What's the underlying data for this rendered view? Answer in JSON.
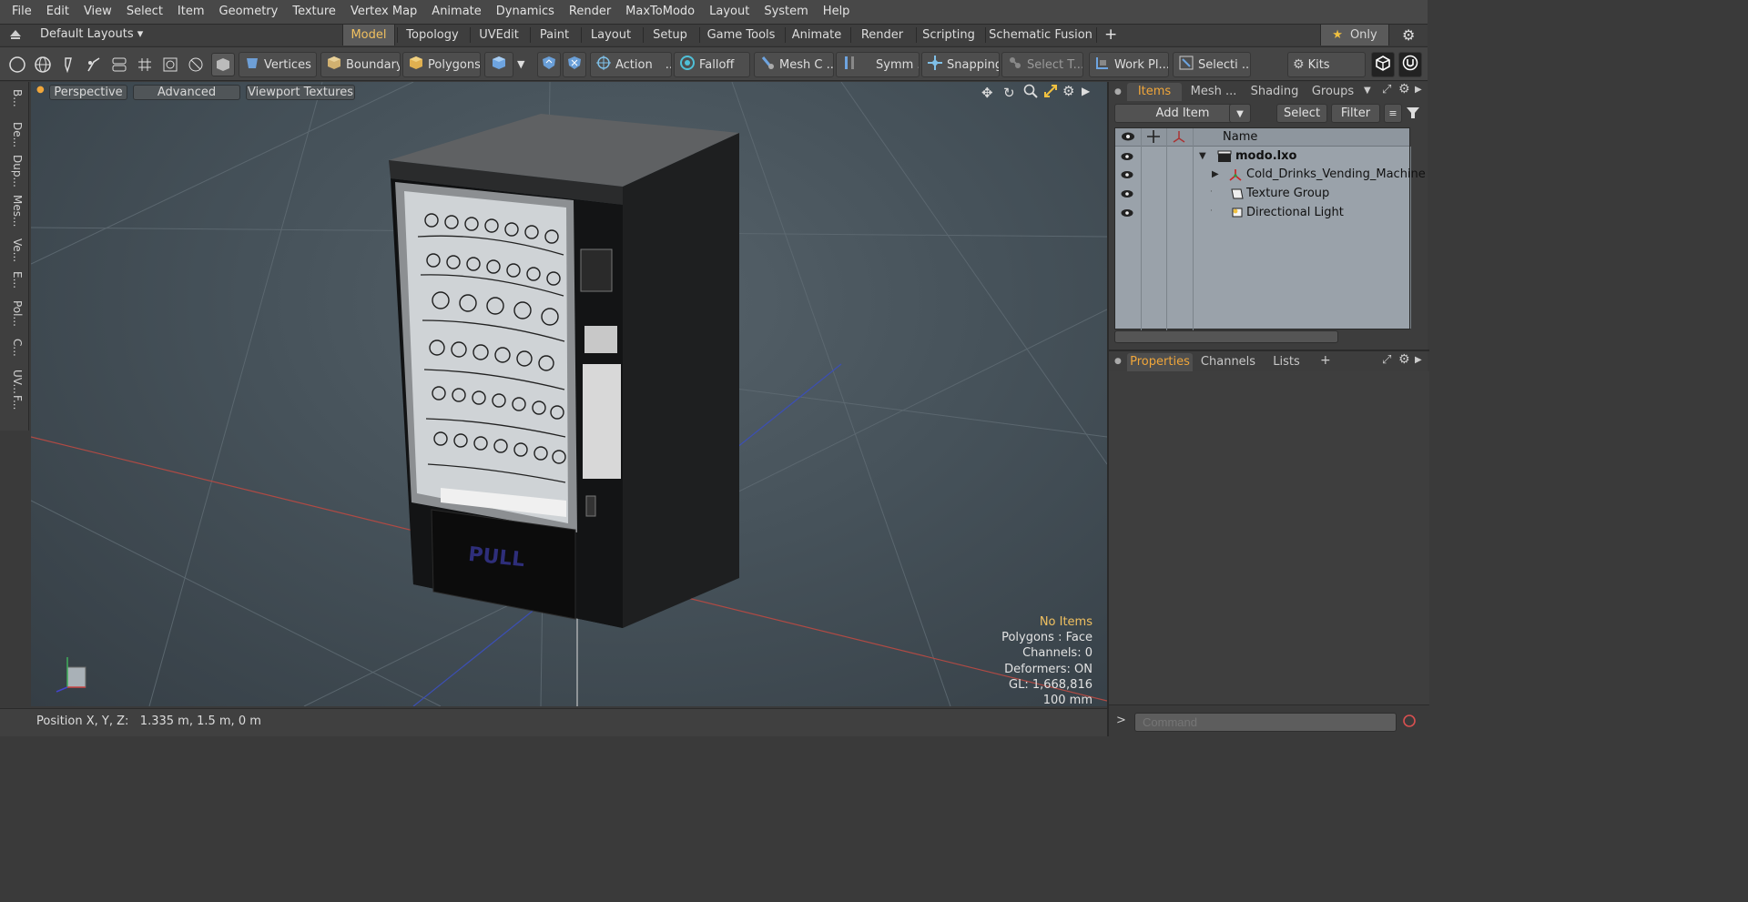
{
  "menu": [
    "File",
    "Edit",
    "View",
    "Select",
    "Item",
    "Geometry",
    "Texture",
    "Vertex Map",
    "Animate",
    "Dynamics",
    "Render",
    "MaxToModo",
    "Layout",
    "System",
    "Help"
  ],
  "layouts": {
    "label": "Default Layouts"
  },
  "tabs": [
    "Model",
    "Topology",
    "UVEdit",
    "Paint",
    "Layout",
    "Setup",
    "Game Tools",
    "Animate",
    "Render",
    "Scripting",
    "Schematic Fusion"
  ],
  "tabs_active": "Model",
  "only_label": "Only",
  "toolbar": {
    "vertices": "Vertices",
    "boundary": "Boundary",
    "polygons": "Polygons",
    "action": "Action",
    "action_more": "...",
    "falloff": "Falloff",
    "meshc": "Mesh C ...",
    "symm": "Symm ...",
    "snapping": "Snapping",
    "selectt": "Select T...",
    "workpl": "Work Pl...",
    "selecti": "Selecti ...",
    "kits": "Kits"
  },
  "left_tabs": [
    "B...",
    "De...",
    "Dup...",
    "Mes...",
    "Ve...",
    "E...",
    "Pol...",
    "C...",
    "UV...",
    "F..."
  ],
  "viewport": {
    "perspective": "Perspective",
    "advanced": "Advanced",
    "textures": "Viewport Textures",
    "pull_text": "PULL",
    "info": [
      "No Items",
      "Polygons : Face",
      "Channels: 0",
      "Deformers: ON",
      "GL: 1,668,816",
      "100 mm"
    ],
    "info_color": "#f0c060"
  },
  "status": {
    "position": "Position X, Y, Z:   1.335 m, 1.5 m, 0 m"
  },
  "items_panel": {
    "tabs": [
      "Items",
      "Mesh ...",
      "Shading",
      "Groups"
    ],
    "add_item": "Add Item",
    "select": "Select",
    "filter": "Filter",
    "col_name": "Name",
    "rows": [
      {
        "name": "modo.lxo"
      },
      {
        "name": "Cold_Drinks_Vending_Machine"
      },
      {
        "name": "Texture Group"
      },
      {
        "name": "Directional Light"
      }
    ]
  },
  "props_panel": {
    "tabs": [
      "Properties",
      "Channels",
      "Lists"
    ],
    "plus": "+"
  },
  "command": {
    "placeholder": "Command"
  },
  "colors": {
    "accent": "#f0a63a",
    "bg": "#3a3a3a",
    "list_bg": "#9aa2aa"
  }
}
